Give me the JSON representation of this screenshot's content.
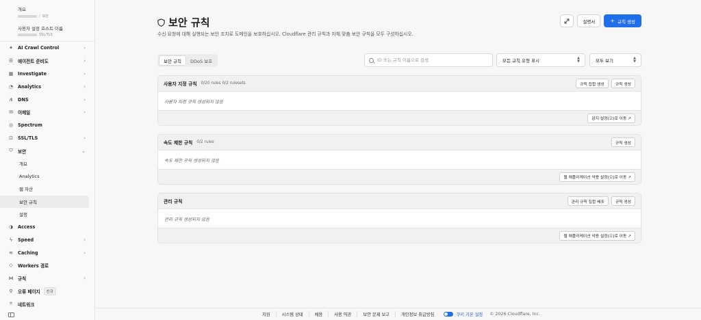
{
  "sidebar": {
    "overview_link": "개요",
    "crumb_tail": "보안",
    "host_title": "사용자 설정 호스트 이름",
    "host_sub": "SSL/TLS",
    "items": [
      {
        "label": "AI Crawl Control",
        "icon": "sparkle-icon",
        "chevron": true
      },
      {
        "label": "에이전트 준비도",
        "icon": "checklist-icon",
        "chevron": true
      },
      {
        "label": "Investigate",
        "icon": "grid-icon",
        "chevron": true
      },
      {
        "label": "Analytics",
        "icon": "chart-icon",
        "chevron": true
      },
      {
        "label": "DNS",
        "icon": "network-icon",
        "chevron": true
      },
      {
        "label": "이메일",
        "icon": "mail-icon",
        "chevron": true
      },
      {
        "label": "Spectrum",
        "icon": "spectrum-icon",
        "chevron": false
      },
      {
        "label": "SSL/TLS",
        "icon": "lock-icon",
        "chevron": true
      },
      {
        "label": "보안",
        "icon": "shield-icon",
        "chevron": true,
        "expanded": true
      }
    ],
    "security_children": [
      "개요",
      "Analytics",
      "웹 자산",
      "보안 규칙",
      "설정"
    ],
    "items_after": [
      {
        "label": "Access",
        "icon": "access-icon",
        "chevron": false
      },
      {
        "label": "Speed",
        "icon": "bolt-icon",
        "chevron": true
      },
      {
        "label": "Caching",
        "icon": "cache-icon",
        "chevron": true
      },
      {
        "label": "Workers 경로",
        "icon": "workers-icon",
        "chevron": false
      },
      {
        "label": "규칙",
        "icon": "rules-icon",
        "chevron": true
      },
      {
        "label": "오류 페이지",
        "icon": "wrench-icon",
        "chevron": false,
        "badge": "신규"
      },
      {
        "label": "네트워크",
        "icon": "pin-icon",
        "chevron": false
      }
    ]
  },
  "header": {
    "title": "보안 규칙",
    "description": "수신 요청에 대해 실행되는 보안 조치로 도메인을 보호하십시오. Cloudflare 관리 규칙과 자체 맞춤 보안 규칙을 모두 구성하십시오.",
    "docs_label": "설명서",
    "create_label": "규칙 생성"
  },
  "tabs": [
    {
      "label": "보안 규칙",
      "active": true
    },
    {
      "label": "DDoS 보호",
      "active": false
    }
  ],
  "search": {
    "placeholder": "ID 또는 규칙 이름으로 검색"
  },
  "filters": {
    "type": "모든 규칙 유형 표시",
    "view": "모두 보기"
  },
  "panels": [
    {
      "title": "사용자 지정 규칙",
      "meta": "0/20 rules  0/2 rulesets",
      "actions": [
        "규칙 집합 생성",
        "규칙 생성"
      ],
      "empty": "사용자 지정 규칙 생성되지 않음",
      "footer": "감지 설정(으)로 이동 ↗"
    },
    {
      "title": "속도 제한 규칙",
      "meta": "0/2 rules",
      "actions": [
        "규칙 생성"
      ],
      "empty": "속도 제한 규칙 생성되지 않음",
      "footer": "웹 애플리케이션 악용 설정(으)로 이동 ↗"
    },
    {
      "title": "관리 규칙",
      "meta": "",
      "actions": [
        "관리 규칙 집합 배포",
        "규칙 생성"
      ],
      "empty": "관리 규칙 생성되지 않음",
      "footer": "웹 애플리케이션 악용 설정(으)로 이동 ↗"
    }
  ],
  "footer": {
    "links": [
      "지원",
      "시스템 상태",
      "채용",
      "사용 약관",
      "보안 문제 보고",
      "개인정보 취급방침"
    ],
    "cookie": "쿠키 기본 설정",
    "copyright": "© 2026 Cloudflare, Inc."
  },
  "colors": {
    "primary": "#1f6feb",
    "link": "#1f5fd6"
  }
}
